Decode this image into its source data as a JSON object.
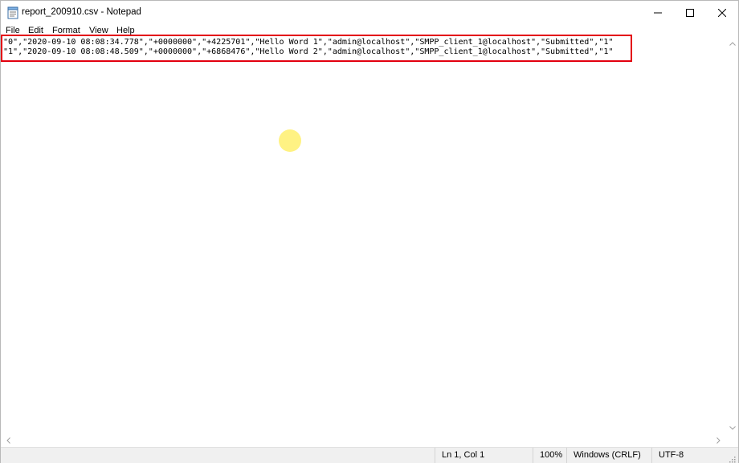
{
  "window": {
    "title": "report_200910.csv - Notepad",
    "icon": "notepad-icon"
  },
  "menu": {
    "items": [
      "File",
      "Edit",
      "Format",
      "View",
      "Help"
    ]
  },
  "editor": {
    "lines": [
      "\"0\",\"2020-09-10 08:08:34.778\",\"+0000000\",\"+4225701\",\"Hello Word 1\",\"admin@localhost\",\"SMPP_client_1@localhost\",\"Submitted\",\"1\"",
      "\"1\",\"2020-09-10 08:08:48.509\",\"+0000000\",\"+6868476\",\"Hello Word 2\",\"admin@localhost\",\"SMPP_client_1@localhost\",\"Submitted\",\"1\""
    ],
    "highlight_color": "#e3000f"
  },
  "status": {
    "position": "Ln 1, Col 1",
    "zoom": "100%",
    "line_ending": "Windows (CRLF)",
    "encoding": "UTF-8"
  }
}
